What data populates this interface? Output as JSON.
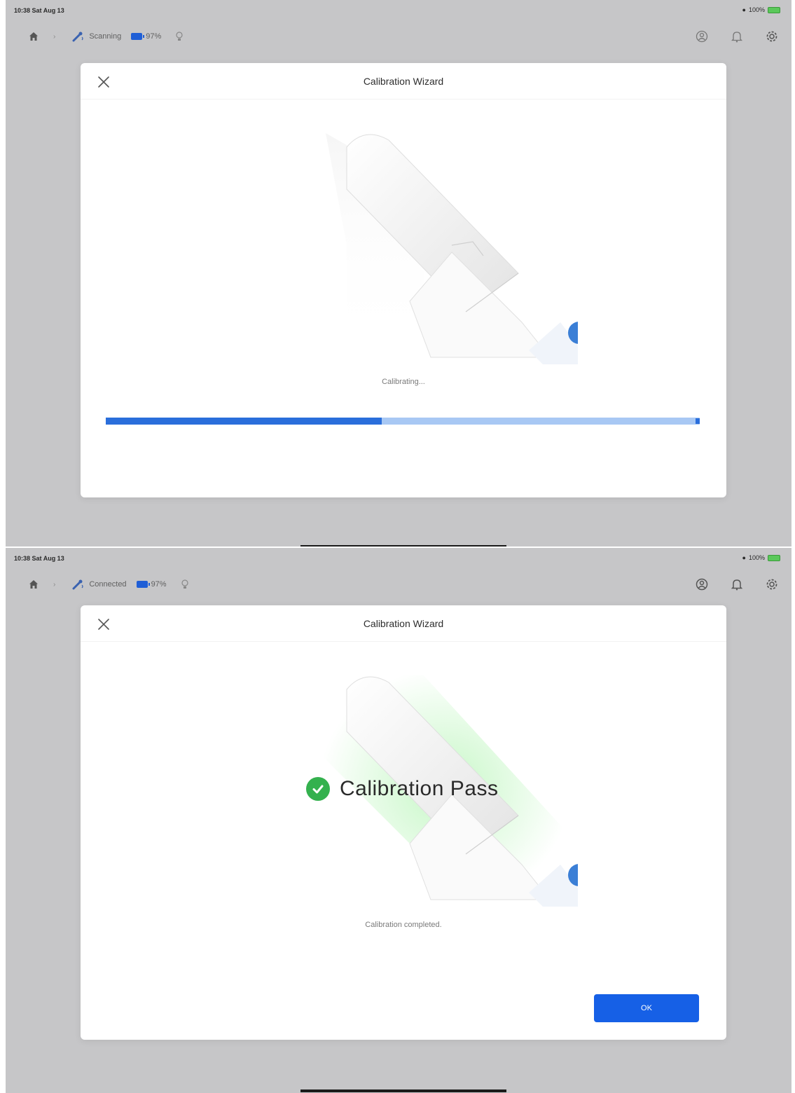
{
  "screens": [
    {
      "status_bar": {
        "time": "10:38 Sat Aug 13",
        "battery": "100%"
      },
      "toolbar": {
        "connection_status": "Scanning",
        "battery_level": "97%"
      },
      "modal": {
        "title": "Calibration Wizard",
        "status_text": "Calibrating...",
        "progress_fraction": 0.465
      }
    },
    {
      "status_bar": {
        "time": "10:38 Sat Aug 13",
        "battery": "100%"
      },
      "toolbar": {
        "connection_status": "Connected",
        "battery_level": "97%"
      },
      "modal": {
        "title": "Calibration Wizard",
        "result": "Calibration Pass",
        "status_text": "Calibration completed.",
        "ok_label": "OK"
      }
    }
  ],
  "colors": {
    "accent": "#1660e6",
    "progress_track": "#a8c8f4",
    "pass_green": "#34b14e"
  }
}
